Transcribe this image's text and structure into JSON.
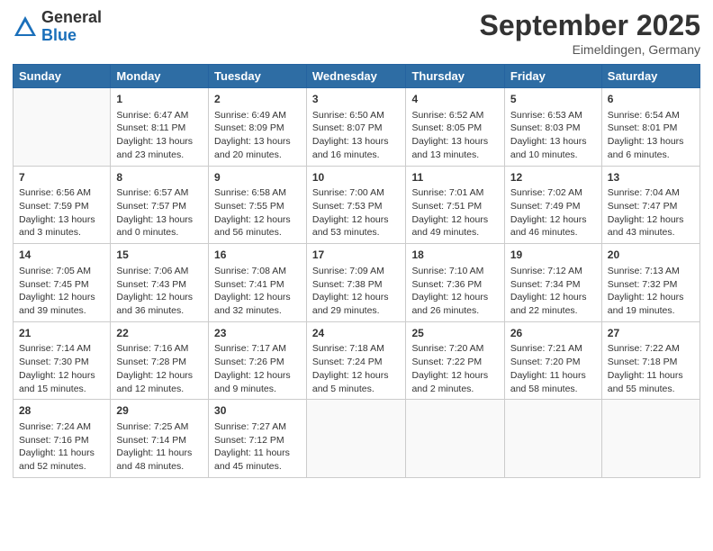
{
  "logo": {
    "general": "General",
    "blue": "Blue"
  },
  "header": {
    "month": "September 2025",
    "location": "Eimeldingen, Germany"
  },
  "days": [
    "Sunday",
    "Monday",
    "Tuesday",
    "Wednesday",
    "Thursday",
    "Friday",
    "Saturday"
  ],
  "weeks": [
    [
      {
        "day": "",
        "content": ""
      },
      {
        "day": "1",
        "content": "Sunrise: 6:47 AM\nSunset: 8:11 PM\nDaylight: 13 hours\nand 23 minutes."
      },
      {
        "day": "2",
        "content": "Sunrise: 6:49 AM\nSunset: 8:09 PM\nDaylight: 13 hours\nand 20 minutes."
      },
      {
        "day": "3",
        "content": "Sunrise: 6:50 AM\nSunset: 8:07 PM\nDaylight: 13 hours\nand 16 minutes."
      },
      {
        "day": "4",
        "content": "Sunrise: 6:52 AM\nSunset: 8:05 PM\nDaylight: 13 hours\nand 13 minutes."
      },
      {
        "day": "5",
        "content": "Sunrise: 6:53 AM\nSunset: 8:03 PM\nDaylight: 13 hours\nand 10 minutes."
      },
      {
        "day": "6",
        "content": "Sunrise: 6:54 AM\nSunset: 8:01 PM\nDaylight: 13 hours\nand 6 minutes."
      }
    ],
    [
      {
        "day": "7",
        "content": "Sunrise: 6:56 AM\nSunset: 7:59 PM\nDaylight: 13 hours\nand 3 minutes."
      },
      {
        "day": "8",
        "content": "Sunrise: 6:57 AM\nSunset: 7:57 PM\nDaylight: 13 hours\nand 0 minutes."
      },
      {
        "day": "9",
        "content": "Sunrise: 6:58 AM\nSunset: 7:55 PM\nDaylight: 12 hours\nand 56 minutes."
      },
      {
        "day": "10",
        "content": "Sunrise: 7:00 AM\nSunset: 7:53 PM\nDaylight: 12 hours\nand 53 minutes."
      },
      {
        "day": "11",
        "content": "Sunrise: 7:01 AM\nSunset: 7:51 PM\nDaylight: 12 hours\nand 49 minutes."
      },
      {
        "day": "12",
        "content": "Sunrise: 7:02 AM\nSunset: 7:49 PM\nDaylight: 12 hours\nand 46 minutes."
      },
      {
        "day": "13",
        "content": "Sunrise: 7:04 AM\nSunset: 7:47 PM\nDaylight: 12 hours\nand 43 minutes."
      }
    ],
    [
      {
        "day": "14",
        "content": "Sunrise: 7:05 AM\nSunset: 7:45 PM\nDaylight: 12 hours\nand 39 minutes."
      },
      {
        "day": "15",
        "content": "Sunrise: 7:06 AM\nSunset: 7:43 PM\nDaylight: 12 hours\nand 36 minutes."
      },
      {
        "day": "16",
        "content": "Sunrise: 7:08 AM\nSunset: 7:41 PM\nDaylight: 12 hours\nand 32 minutes."
      },
      {
        "day": "17",
        "content": "Sunrise: 7:09 AM\nSunset: 7:38 PM\nDaylight: 12 hours\nand 29 minutes."
      },
      {
        "day": "18",
        "content": "Sunrise: 7:10 AM\nSunset: 7:36 PM\nDaylight: 12 hours\nand 26 minutes."
      },
      {
        "day": "19",
        "content": "Sunrise: 7:12 AM\nSunset: 7:34 PM\nDaylight: 12 hours\nand 22 minutes."
      },
      {
        "day": "20",
        "content": "Sunrise: 7:13 AM\nSunset: 7:32 PM\nDaylight: 12 hours\nand 19 minutes."
      }
    ],
    [
      {
        "day": "21",
        "content": "Sunrise: 7:14 AM\nSunset: 7:30 PM\nDaylight: 12 hours\nand 15 minutes."
      },
      {
        "day": "22",
        "content": "Sunrise: 7:16 AM\nSunset: 7:28 PM\nDaylight: 12 hours\nand 12 minutes."
      },
      {
        "day": "23",
        "content": "Sunrise: 7:17 AM\nSunset: 7:26 PM\nDaylight: 12 hours\nand 9 minutes."
      },
      {
        "day": "24",
        "content": "Sunrise: 7:18 AM\nSunset: 7:24 PM\nDaylight: 12 hours\nand 5 minutes."
      },
      {
        "day": "25",
        "content": "Sunrise: 7:20 AM\nSunset: 7:22 PM\nDaylight: 12 hours\nand 2 minutes."
      },
      {
        "day": "26",
        "content": "Sunrise: 7:21 AM\nSunset: 7:20 PM\nDaylight: 11 hours\nand 58 minutes."
      },
      {
        "day": "27",
        "content": "Sunrise: 7:22 AM\nSunset: 7:18 PM\nDaylight: 11 hours\nand 55 minutes."
      }
    ],
    [
      {
        "day": "28",
        "content": "Sunrise: 7:24 AM\nSunset: 7:16 PM\nDaylight: 11 hours\nand 52 minutes."
      },
      {
        "day": "29",
        "content": "Sunrise: 7:25 AM\nSunset: 7:14 PM\nDaylight: 11 hours\nand 48 minutes."
      },
      {
        "day": "30",
        "content": "Sunrise: 7:27 AM\nSunset: 7:12 PM\nDaylight: 11 hours\nand 45 minutes."
      },
      {
        "day": "",
        "content": ""
      },
      {
        "day": "",
        "content": ""
      },
      {
        "day": "",
        "content": ""
      },
      {
        "day": "",
        "content": ""
      }
    ]
  ]
}
